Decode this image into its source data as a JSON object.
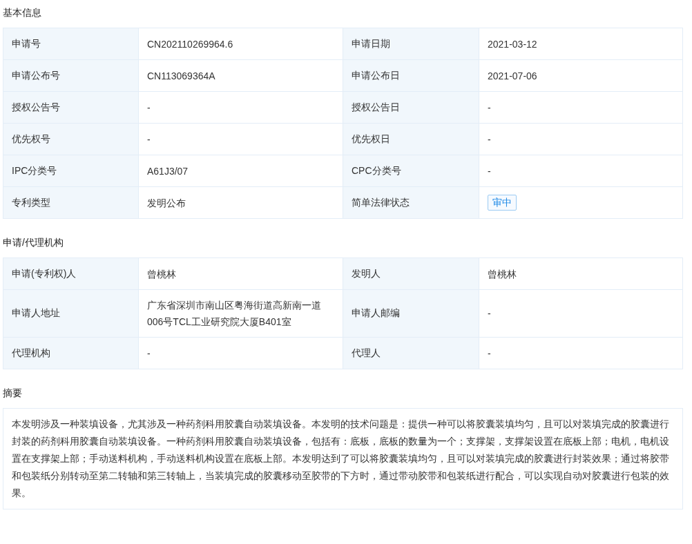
{
  "sections": [
    {
      "title": "基本信息",
      "rows": [
        [
          {
            "label": "申请号",
            "value": "CN202110269964.6",
            "kind": "text"
          },
          {
            "label": "申请日期",
            "value": "2021-03-12",
            "kind": "text"
          }
        ],
        [
          {
            "label": "申请公布号",
            "value": "CN113069364A",
            "kind": "text"
          },
          {
            "label": "申请公布日",
            "value": "2021-07-06",
            "kind": "text"
          }
        ],
        [
          {
            "label": "授权公告号",
            "value": "-",
            "kind": "text"
          },
          {
            "label": "授权公告日",
            "value": "-",
            "kind": "text"
          }
        ],
        [
          {
            "label": "优先权号",
            "value": "-",
            "kind": "text"
          },
          {
            "label": "优先权日",
            "value": "-",
            "kind": "text"
          }
        ],
        [
          {
            "label": "IPC分类号",
            "value": "A61J3/07",
            "kind": "text"
          },
          {
            "label": "CPC分类号",
            "value": "-",
            "kind": "text"
          }
        ],
        [
          {
            "label": "专利类型",
            "value": "发明公布",
            "kind": "text"
          },
          {
            "label": "简单法律状态",
            "value": "审中",
            "kind": "badge"
          }
        ]
      ]
    },
    {
      "title": "申请/代理机构",
      "rows": [
        [
          {
            "label": "申请(专利权)人",
            "value": "曾桃林",
            "kind": "text"
          },
          {
            "label": "发明人",
            "value": "曾桃林",
            "kind": "text"
          }
        ],
        [
          {
            "label": "申请人地址",
            "value": "广东省深圳市南山区粤海街道高新南一道006号TCL工业研究院大厦B401室",
            "kind": "text"
          },
          {
            "label": "申请人邮编",
            "value": "-",
            "kind": "text"
          }
        ],
        [
          {
            "label": "代理机构",
            "value": "-",
            "kind": "text"
          },
          {
            "label": "代理人",
            "value": "-",
            "kind": "text"
          }
        ]
      ]
    }
  ],
  "abstract": {
    "title": "摘要",
    "text": "本发明涉及一种装填设备，尤其涉及一种药剂科用胶囊自动装填设备。本发明的技术问题是：提供一种可以将胶囊装填均匀，且可以对装填完成的胶囊进行封装的药剂科用胶囊自动装填设备。一种药剂科用胶囊自动装填设备，包括有：底板，底板的数量为一个；支撑架，支撑架设置在底板上部；电机，电机设置在支撑架上部；手动送料机构，手动送料机构设置在底板上部。本发明达到了可以将胶囊装填均匀，且可以对装填完成的胶囊进行封装效果；通过将胶带和包装纸分别转动至第二转轴和第三转轴上，当装填完成的胶囊移动至胶带的下方时，通过带动胶带和包装纸进行配合，可以实现自动对胶囊进行包装的效果。"
  }
}
